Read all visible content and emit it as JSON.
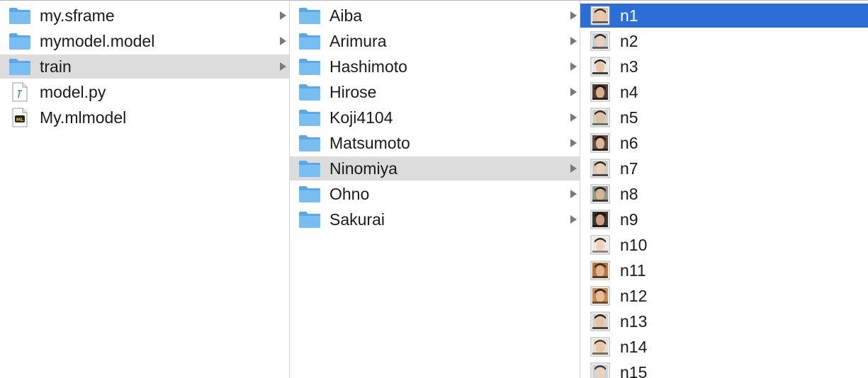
{
  "column1": {
    "items": [
      {
        "label": "my.sframe",
        "icon": "folder-icon",
        "has_children": true
      },
      {
        "label": "mymodel.model",
        "icon": "folder-icon",
        "has_children": true
      },
      {
        "label": "train",
        "icon": "folder-icon",
        "has_children": true,
        "selected": true
      },
      {
        "label": "model.py",
        "icon": "python-file-icon",
        "has_children": false
      },
      {
        "label": "My.mlmodel",
        "icon": "mlmodel-file-icon",
        "has_children": false
      }
    ]
  },
  "column2": {
    "items": [
      {
        "label": "Aiba",
        "icon": "folder-icon",
        "has_children": true
      },
      {
        "label": "Arimura",
        "icon": "folder-icon",
        "has_children": true
      },
      {
        "label": "Hashimoto",
        "icon": "folder-icon",
        "has_children": true
      },
      {
        "label": "Hirose",
        "icon": "folder-icon",
        "has_children": true
      },
      {
        "label": "Koji4104",
        "icon": "folder-icon",
        "has_children": true
      },
      {
        "label": "Matsumoto",
        "icon": "folder-icon",
        "has_children": true
      },
      {
        "label": "Ninomiya",
        "icon": "folder-icon",
        "has_children": true,
        "selected": true
      },
      {
        "label": "Ohno",
        "icon": "folder-icon",
        "has_children": true
      },
      {
        "label": "Sakurai",
        "icon": "folder-icon",
        "has_children": true
      }
    ]
  },
  "column3": {
    "items": [
      {
        "label": "n1",
        "icon": "image-thumbnail-icon",
        "active": true
      },
      {
        "label": "n2",
        "icon": "image-thumbnail-icon"
      },
      {
        "label": "n3",
        "icon": "image-thumbnail-icon"
      },
      {
        "label": "n4",
        "icon": "image-thumbnail-icon"
      },
      {
        "label": "n5",
        "icon": "image-thumbnail-icon"
      },
      {
        "label": "n6",
        "icon": "image-thumbnail-icon"
      },
      {
        "label": "n7",
        "icon": "image-thumbnail-icon"
      },
      {
        "label": "n8",
        "icon": "image-thumbnail-icon"
      },
      {
        "label": "n9",
        "icon": "image-thumbnail-icon"
      },
      {
        "label": "n10",
        "icon": "image-thumbnail-icon"
      },
      {
        "label": "n11",
        "icon": "image-thumbnail-icon"
      },
      {
        "label": "n12",
        "icon": "image-thumbnail-icon"
      },
      {
        "label": "n13",
        "icon": "image-thumbnail-icon"
      },
      {
        "label": "n14",
        "icon": "image-thumbnail-icon"
      },
      {
        "label": "n15",
        "icon": "image-thumbnail-icon"
      }
    ]
  },
  "colors": {
    "folder": "#78bef0",
    "selected_gray": "#dcdcdc",
    "selected_blue": "#2b6fd6",
    "arrow": "#7a7a7a"
  }
}
